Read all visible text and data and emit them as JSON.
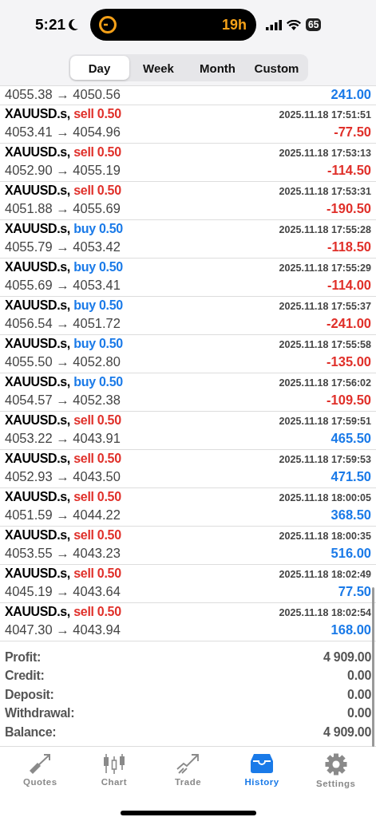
{
  "status_bar": {
    "time": "5:21",
    "activity_timer": "19h",
    "battery": "65"
  },
  "period_tabs": [
    {
      "label": "Day",
      "selected": true
    },
    {
      "label": "Week",
      "selected": false
    },
    {
      "label": "Month",
      "selected": false
    },
    {
      "label": "Custom",
      "selected": false
    }
  ],
  "partial_deal": {
    "prices": "4055.38 → 4050.56",
    "profit": "241.00",
    "color": "#1a7ae8"
  },
  "deals": [
    {
      "symbol": "XAUUSD.s,",
      "order": "sell 0.50",
      "kind": "sell",
      "time": "2025.11.18 17:51:51",
      "prices": "4053.41 → 4054.96",
      "profit": "-77.50",
      "color": "#e0302a"
    },
    {
      "symbol": "XAUUSD.s,",
      "order": "sell 0.50",
      "kind": "sell",
      "time": "2025.11.18 17:53:13",
      "prices": "4052.90 → 4055.19",
      "profit": "-114.50",
      "color": "#e0302a"
    },
    {
      "symbol": "XAUUSD.s,",
      "order": "sell 0.50",
      "kind": "sell",
      "time": "2025.11.18 17:53:31",
      "prices": "4051.88 → 4055.69",
      "profit": "-190.50",
      "color": "#e0302a"
    },
    {
      "symbol": "XAUUSD.s,",
      "order": "buy 0.50",
      "kind": "buy",
      "time": "2025.11.18 17:55:28",
      "prices": "4055.79 → 4053.42",
      "profit": "-118.50",
      "color": "#e0302a"
    },
    {
      "symbol": "XAUUSD.s,",
      "order": "buy 0.50",
      "kind": "buy",
      "time": "2025.11.18 17:55:29",
      "prices": "4055.69 → 4053.41",
      "profit": "-114.00",
      "color": "#e0302a"
    },
    {
      "symbol": "XAUUSD.s,",
      "order": "buy 0.50",
      "kind": "buy",
      "time": "2025.11.18 17:55:37",
      "prices": "4056.54 → 4051.72",
      "profit": "-241.00",
      "color": "#e0302a"
    },
    {
      "symbol": "XAUUSD.s,",
      "order": "buy 0.50",
      "kind": "buy",
      "time": "2025.11.18 17:55:58",
      "prices": "4055.50 → 4052.80",
      "profit": "-135.00",
      "color": "#e0302a"
    },
    {
      "symbol": "XAUUSD.s,",
      "order": "buy 0.50",
      "kind": "buy",
      "time": "2025.11.18 17:56:02",
      "prices": "4054.57 → 4052.38",
      "profit": "-109.50",
      "color": "#e0302a"
    },
    {
      "symbol": "XAUUSD.s,",
      "order": "sell 0.50",
      "kind": "sell",
      "time": "2025.11.18 17:59:51",
      "prices": "4053.22 → 4043.91",
      "profit": "465.50",
      "color": "#1a7ae8"
    },
    {
      "symbol": "XAUUSD.s,",
      "order": "sell 0.50",
      "kind": "sell",
      "time": "2025.11.18 17:59:53",
      "prices": "4052.93 → 4043.50",
      "profit": "471.50",
      "color": "#1a7ae8"
    },
    {
      "symbol": "XAUUSD.s,",
      "order": "sell 0.50",
      "kind": "sell",
      "time": "2025.11.18 18:00:05",
      "prices": "4051.59 → 4044.22",
      "profit": "368.50",
      "color": "#1a7ae8"
    },
    {
      "symbol": "XAUUSD.s,",
      "order": "sell 0.50",
      "kind": "sell",
      "time": "2025.11.18 18:00:35",
      "prices": "4053.55 → 4043.23",
      "profit": "516.00",
      "color": "#1a7ae8"
    },
    {
      "symbol": "XAUUSD.s,",
      "order": "sell 0.50",
      "kind": "sell",
      "time": "2025.11.18 18:02:49",
      "prices": "4045.19 → 4043.64",
      "profit": "77.50",
      "color": "#1a7ae8"
    },
    {
      "symbol": "XAUUSD.s,",
      "order": "sell 0.50",
      "kind": "sell",
      "time": "2025.11.18 18:02:54",
      "prices": "4047.30 → 4043.94",
      "profit": "168.00",
      "color": "#1a7ae8"
    }
  ],
  "summary": [
    {
      "label": "Profit:",
      "value": "4 909.00"
    },
    {
      "label": "Credit:",
      "value": "0.00"
    },
    {
      "label": "Deposit:",
      "value": "0.00"
    },
    {
      "label": "Withdrawal:",
      "value": "0.00"
    },
    {
      "label": "Balance:",
      "value": "4 909.00"
    }
  ],
  "tab_bar": [
    {
      "label": "Quotes",
      "kind": "quotes",
      "selected": false
    },
    {
      "label": "Chart",
      "kind": "chart",
      "selected": false
    },
    {
      "label": "Trade",
      "kind": "trade",
      "selected": false
    },
    {
      "label": "History",
      "kind": "history",
      "selected": true
    },
    {
      "label": "Settings",
      "kind": "settings",
      "selected": false
    }
  ]
}
